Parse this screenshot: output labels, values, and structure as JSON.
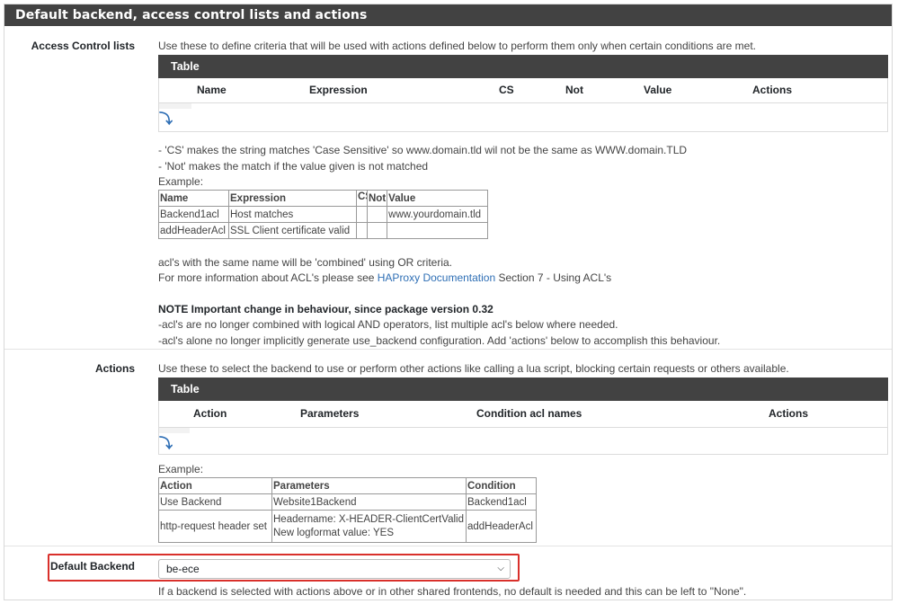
{
  "panel": {
    "title": "Default backend, access control lists and actions"
  },
  "acl": {
    "label": "Access Control lists",
    "help": "Use these to define criteria that will be used with actions defined below to perform them only when certain conditions are met.",
    "table_title": "Table",
    "columns": [
      "Name",
      "Expression",
      "CS",
      "Not",
      "Value",
      "Actions"
    ],
    "add_icon": "add-row-icon",
    "notes": [
      "- 'CS' makes the string matches 'Case Sensitive' so www.domain.tld wil not be the same as WWW.domain.TLD",
      "- 'Not' makes the match if the value given is not matched"
    ],
    "example_label": "Example:",
    "example": {
      "headers": [
        "Name",
        "Expression",
        "CS",
        "Not",
        "Value"
      ],
      "rows": [
        [
          "Backend1acl",
          "Host matches",
          "",
          "",
          "www.yourdomain.tld"
        ],
        [
          "addHeaderAcl",
          "SSL Client certificate valid",
          "",
          "",
          ""
        ]
      ]
    },
    "combined_note": "acl's with the same name will be 'combined' using OR criteria.",
    "more_info_prefix": "For more information about ACL's please see",
    "more_info_link": "HAProxy Documentation",
    "more_info_suffix": "Section 7 - Using ACL's",
    "important_title": "NOTE Important change in behaviour, since package version 0.32",
    "important_lines": [
      "-acl's are no longer combined with logical AND operators, list multiple acl's below where needed.",
      "-acl's alone no longer implicitly generate use_backend configuration. Add 'actions' below to accomplish this behaviour."
    ]
  },
  "actions": {
    "label": "Actions",
    "help": "Use these to select the backend to use or perform other actions like calling a lua script, blocking certain requests or others available.",
    "table_title": "Table",
    "columns": [
      "Action",
      "Parameters",
      "Condition acl names",
      "Actions"
    ],
    "add_icon": "add-row-icon",
    "example_label": "Example:",
    "example": {
      "headers": [
        "Action",
        "Parameters",
        "Condition"
      ],
      "rows": [
        [
          "Use Backend",
          [
            "Website1Backend"
          ],
          "Backend1acl"
        ],
        [
          "http-request header set",
          [
            "Headername: X-HEADER-ClientCertValid",
            "New logformat value: YES"
          ],
          "addHeaderAcl"
        ]
      ]
    }
  },
  "default_backend": {
    "label": "Default Backend",
    "selected": "be-ece",
    "help": "If a backend is selected with actions above or in other shared frontends, no default is needed and this can be left to \"None\".",
    "highlight_color": "#d9302b"
  }
}
